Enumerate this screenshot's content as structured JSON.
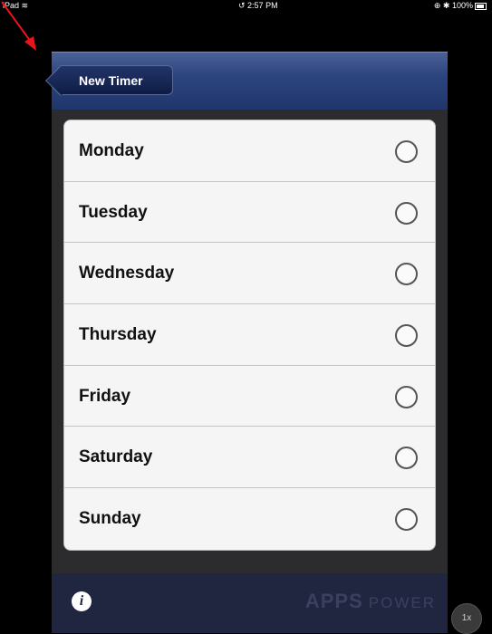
{
  "status_bar": {
    "device": "iPad",
    "wifi_icon": "wifi-icon",
    "time": "2:57 PM",
    "right": "100%"
  },
  "navbar": {
    "back_label": "New Timer"
  },
  "days": [
    {
      "label": "Monday",
      "selected": false
    },
    {
      "label": "Tuesday",
      "selected": false
    },
    {
      "label": "Wednesday",
      "selected": false
    },
    {
      "label": "Thursday",
      "selected": false
    },
    {
      "label": "Friday",
      "selected": false
    },
    {
      "label": "Saturday",
      "selected": false
    },
    {
      "label": "Sunday",
      "selected": false
    }
  ],
  "footer": {
    "info_glyph": "i",
    "brand_apps": "APPS",
    "brand_power": "POWER"
  },
  "zoom": "1x",
  "colors": {
    "navbar": "#2d457f",
    "background": "#2c2c2e",
    "annotation_arrow": "#e8141b"
  }
}
